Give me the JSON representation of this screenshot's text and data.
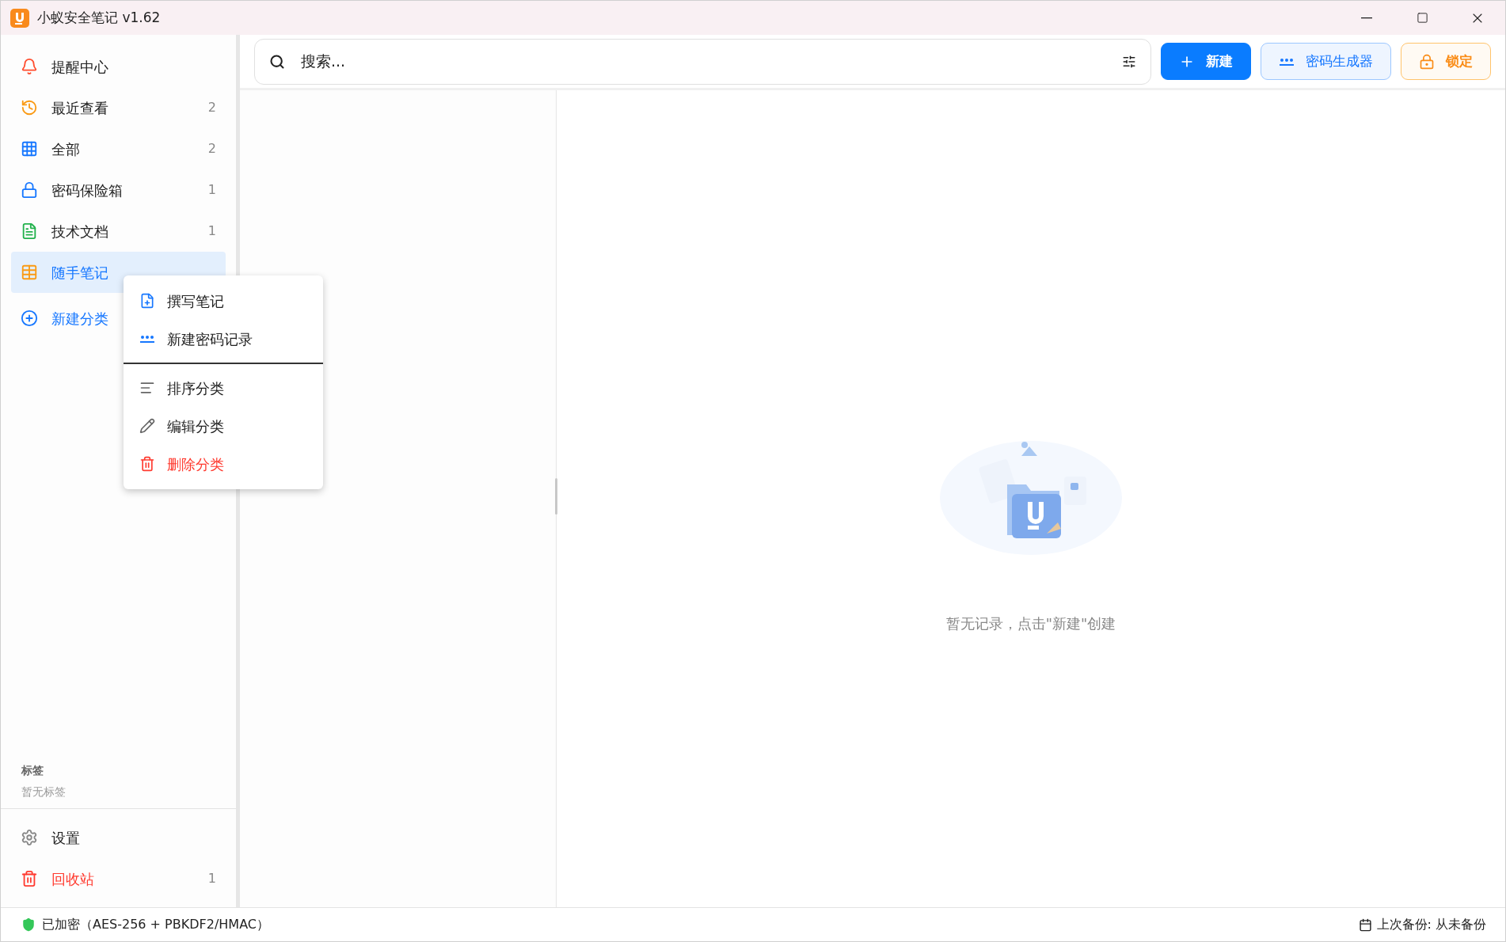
{
  "window": {
    "title": "小蚁安全笔记 v1.62"
  },
  "sidebar": {
    "items": [
      {
        "label": "提醒中心",
        "kind": "category",
        "selected": false
      },
      {
        "label": "最近查看",
        "count": "2",
        "kind": "category",
        "selected": false
      },
      {
        "label": "全部",
        "count": "2",
        "kind": "category",
        "selected": false
      },
      {
        "label": "密码保险箱",
        "count": "1",
        "kind": "category",
        "selected": false
      },
      {
        "label": "技术文档",
        "count": "1",
        "kind": "category",
        "selected": false
      },
      {
        "label": "随手笔记",
        "kind": "category",
        "selected": true
      },
      {
        "label": "新建分类",
        "kind": "action",
        "selected": false
      }
    ],
    "tags": {
      "heading": "标签",
      "empty": "暂无标签"
    },
    "footer": [
      {
        "label": "设置",
        "kind": "normal"
      },
      {
        "label": "回收站",
        "count": "1",
        "kind": "danger"
      }
    ]
  },
  "context_menu": {
    "groups": [
      [
        {
          "label": "撰写笔记",
          "kind": "normal"
        },
        {
          "label": "新建密码记录",
          "kind": "normal"
        }
      ],
      [
        {
          "label": "排序分类",
          "kind": "normal"
        },
        {
          "label": "编辑分类",
          "kind": "normal"
        },
        {
          "label": "删除分类",
          "kind": "danger"
        }
      ]
    ]
  },
  "toolbar": {
    "search": {
      "placeholder": "搜索..."
    },
    "buttons": [
      {
        "label": "新建",
        "kind": "primary"
      },
      {
        "label": "密码生成器",
        "kind": "secondary"
      },
      {
        "label": "锁定",
        "kind": "warning"
      }
    ]
  },
  "empty_state": {
    "text": "暂无记录，点击\"新建\"创建"
  },
  "status_bar": {
    "left": "已加密（AES-256 + PBKDF2/HMAC）",
    "right": "上次备份: 从未备份"
  }
}
